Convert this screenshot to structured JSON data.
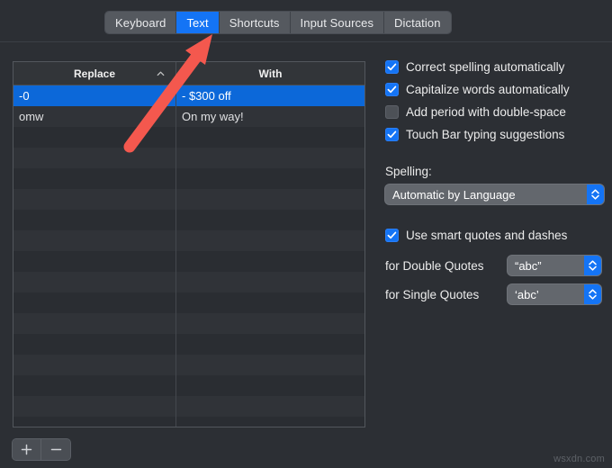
{
  "window": {
    "pane_title": "Keyboard",
    "background_color": "#2c2f34",
    "accent_color": "#1474f5"
  },
  "tabs": [
    {
      "label": "Keyboard",
      "active": false
    },
    {
      "label": "Text",
      "active": true
    },
    {
      "label": "Shortcuts",
      "active": false
    },
    {
      "label": "Input Sources",
      "active": false
    },
    {
      "label": "Dictation",
      "active": false
    }
  ],
  "table": {
    "columns": [
      {
        "header": "Replace",
        "sort_indicator": "chevron-up-icon"
      },
      {
        "header": "With",
        "sort_indicator": ""
      }
    ],
    "rows": [
      {
        "replace": "-0",
        "with": "- $300 off",
        "selected": true
      },
      {
        "replace": "omw",
        "with": "On my way!",
        "selected": false
      }
    ],
    "empty_row_count": 15,
    "selected_row_color": "#0c68d9"
  },
  "table_buttons": [
    {
      "name": "add",
      "glyph": "plus-icon"
    },
    {
      "name": "remove",
      "glyph": "minus-icon"
    }
  ],
  "options": {
    "checkboxes": [
      {
        "label": "Correct spelling automatically",
        "checked": true
      },
      {
        "label": "Capitalize words automatically",
        "checked": true
      },
      {
        "label": "Add period with double-space",
        "checked": false
      },
      {
        "label": "Touch Bar typing suggestions",
        "checked": true
      }
    ],
    "spelling": {
      "label": "Spelling:",
      "value": "Automatic by Language"
    },
    "smart_quotes": {
      "label": "Use smart quotes and dashes",
      "checked": true,
      "double_quotes": {
        "label": "for Double Quotes",
        "value": "“abc”"
      },
      "single_quotes": {
        "label": "for Single Quotes",
        "value": "‘abc’"
      }
    }
  },
  "annotation": {
    "type": "arrow",
    "color": "#f4584e",
    "points_to": "Text"
  },
  "watermark": "wsxdn.com"
}
